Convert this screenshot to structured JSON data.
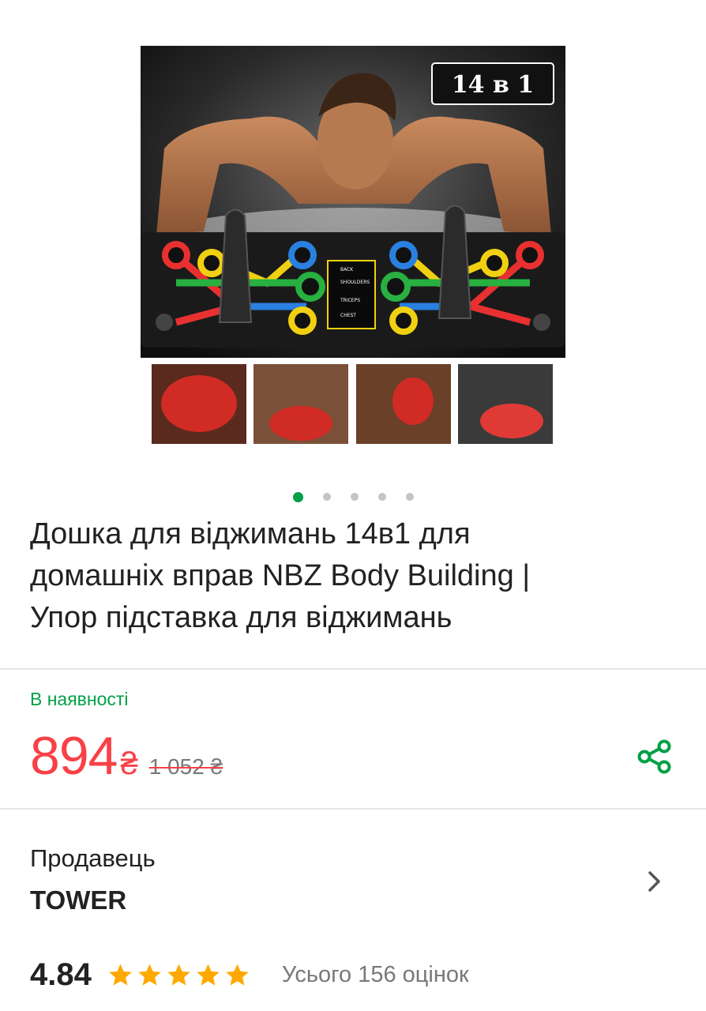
{
  "gallery": {
    "badge": "14 в 1",
    "board_labels": [
      "BACK",
      "SHOULDERS",
      "TRICEPS",
      "CHEST"
    ],
    "slide_count": 5,
    "active_slide": 1
  },
  "product": {
    "title_line1": "Дошка для віджимань 14в1 для",
    "title_line2": "домашніх вправ NBZ Body Building |",
    "title_line3": "Упор підставка для віджимань"
  },
  "availability": "В наявності",
  "price": {
    "current": "894",
    "currency": "₴",
    "old": "1 052 ₴"
  },
  "seller": {
    "label": "Продавець",
    "name": "TOWER"
  },
  "rating": {
    "value": "4.84",
    "stars": 5,
    "reviews_text": "Усього 156 оцінок"
  },
  "colors": {
    "accent_green": "#00a046",
    "price_red": "#f84147",
    "star_orange": "#ffa900"
  },
  "icons": {
    "share": "share-icon",
    "chevron": "chevron-right-icon",
    "star": "star-icon"
  }
}
